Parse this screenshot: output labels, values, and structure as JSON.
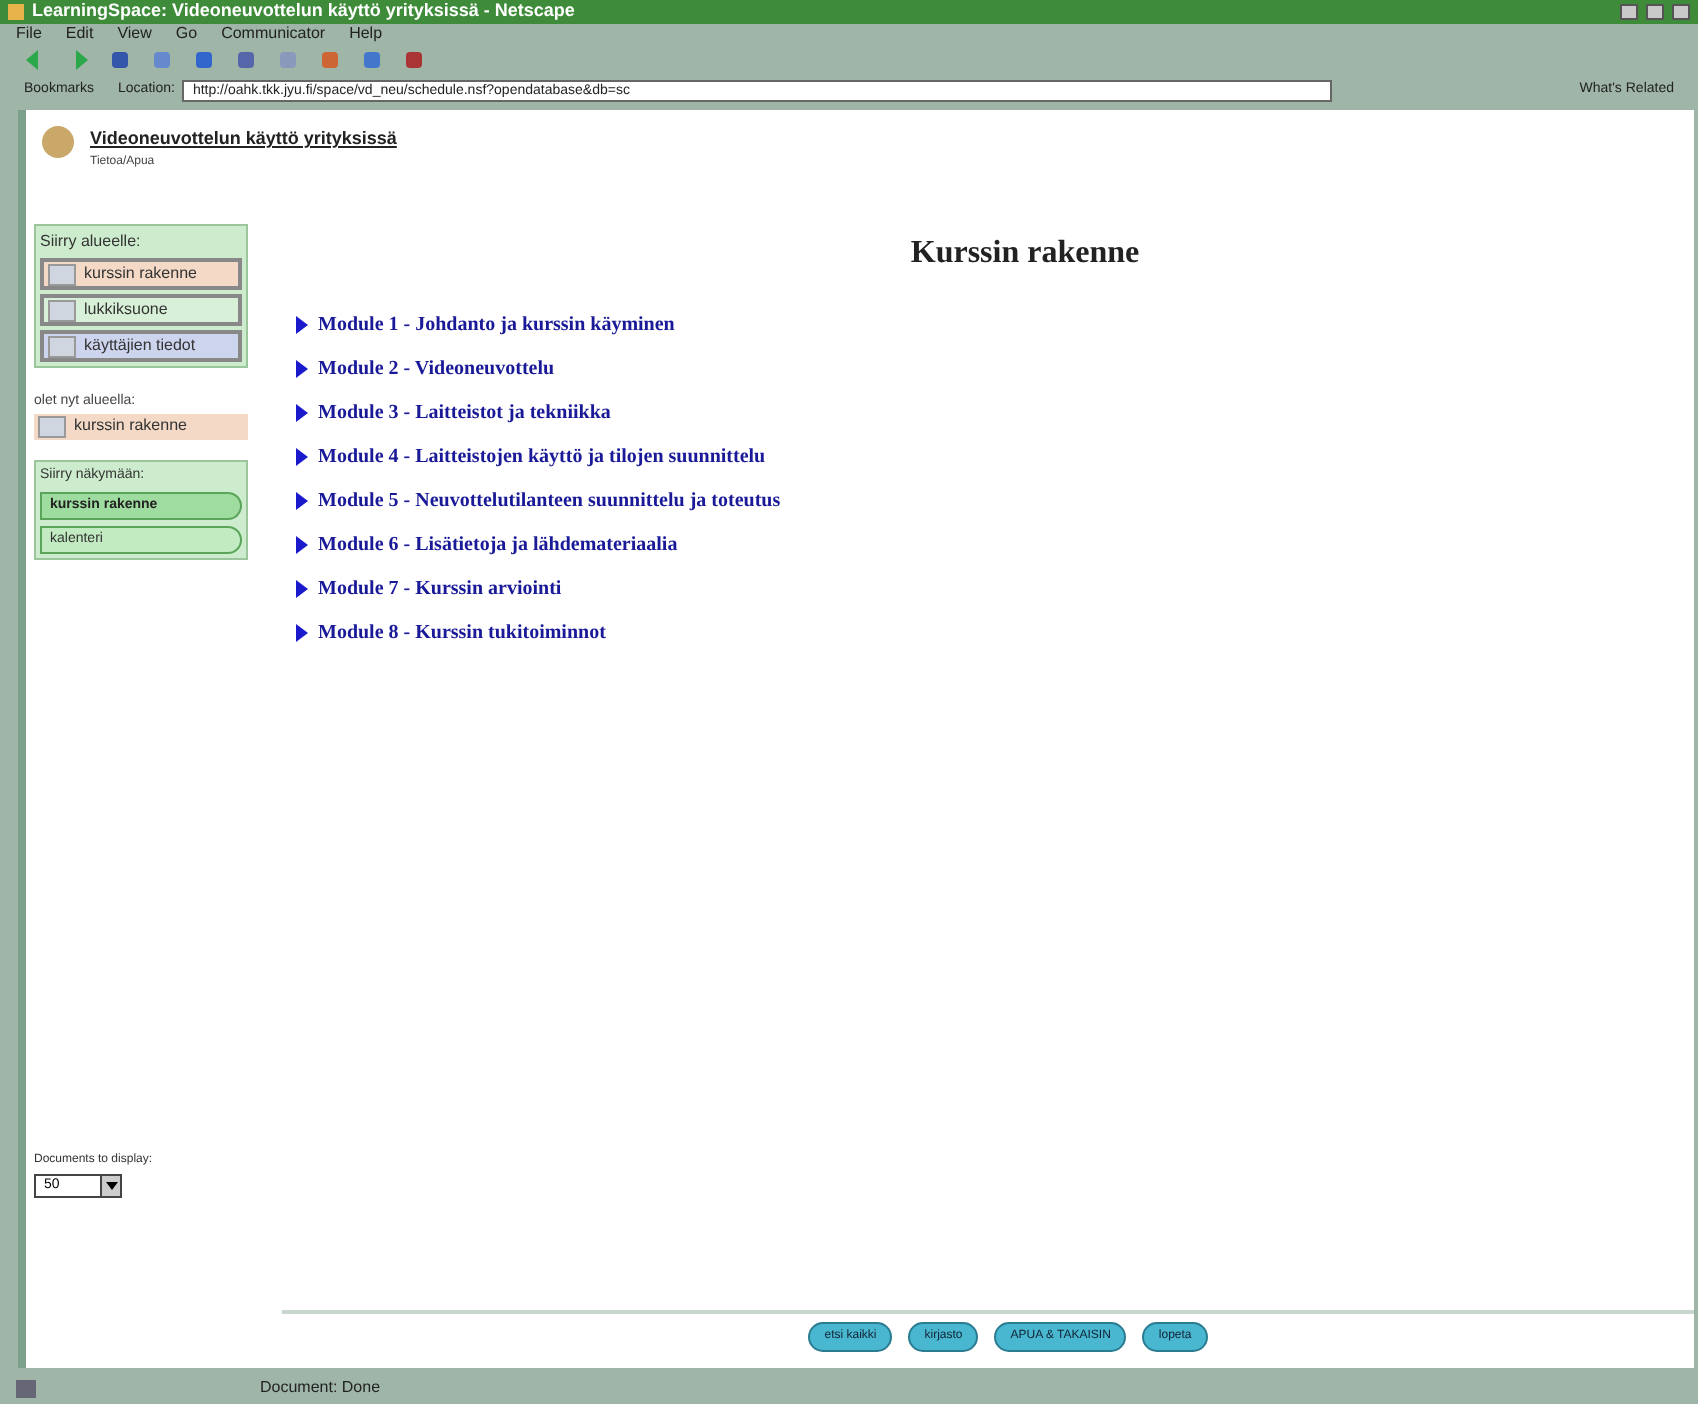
{
  "window": {
    "title": "LearningSpace: Videoneuvottelun käyttö yrityksissä - Netscape"
  },
  "menu": [
    "File",
    "Edit",
    "View",
    "Go",
    "Communicator",
    "Help"
  ],
  "location_bar": {
    "bookmarks": "Bookmarks",
    "location_label": "Location:",
    "url": "http://oahk.tkk.jyu.fi/space/vd_neu/schedule.nsf?opendatabase&db=sc",
    "related": "What's Related"
  },
  "course": {
    "title": "Videoneuvottelun käyttö yrityksissä",
    "subtitle": "Tietoa/Apua"
  },
  "sidebar": {
    "areas_heading": "Siirry alueelle:",
    "areas": [
      {
        "label": "kurssin rakenne",
        "color": "#f3d9c6"
      },
      {
        "label": "lukkiksuone",
        "color": "#d7f0d7"
      },
      {
        "label": "käyttäjien tiedot",
        "color": "#cdd4ee"
      }
    ],
    "current_heading": "olet nyt alueella:",
    "current": {
      "label": "kurssin rakenne",
      "color": "#f3d9c6"
    },
    "views_heading": "Siirry näkymään:",
    "views": [
      {
        "label": "kurssin rakenne",
        "selected": true
      },
      {
        "label": "kalenteri",
        "selected": false
      }
    ],
    "docs_label": "Documents to display:",
    "docs_value": "50"
  },
  "main": {
    "heading": "Kurssin rakenne",
    "modules": [
      "Module 1 - Johdanto ja kurssin käyminen",
      "Module 2 - Videoneuvottelu",
      "Module 3 - Laitteistot ja tekniikka",
      "Module 4 - Laitteistojen käyttö ja tilojen suunnittelu",
      "Module 5 - Neuvottelutilanteen suunnittelu ja toteutus",
      "Module 6 - Lisätietoja ja lähdemateriaalia",
      "Module 7 - Kurssin arviointi",
      "Module 8 - Kurssin tukitoiminnot"
    ]
  },
  "bottom_buttons": [
    "etsi kaikki",
    "kirjasto",
    "APUA & TAKAISIN",
    "lopeta"
  ],
  "status_bar": {
    "text": "Document: Done"
  }
}
